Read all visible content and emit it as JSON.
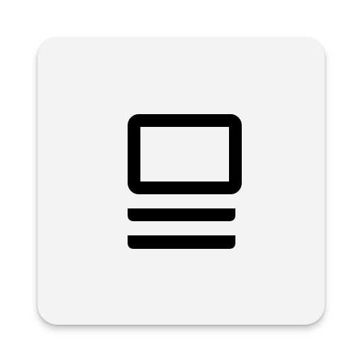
{
  "app_icon": {
    "icon": "article-icon",
    "tile_color": "#f4f3f2",
    "glyph_color": "#000000"
  }
}
